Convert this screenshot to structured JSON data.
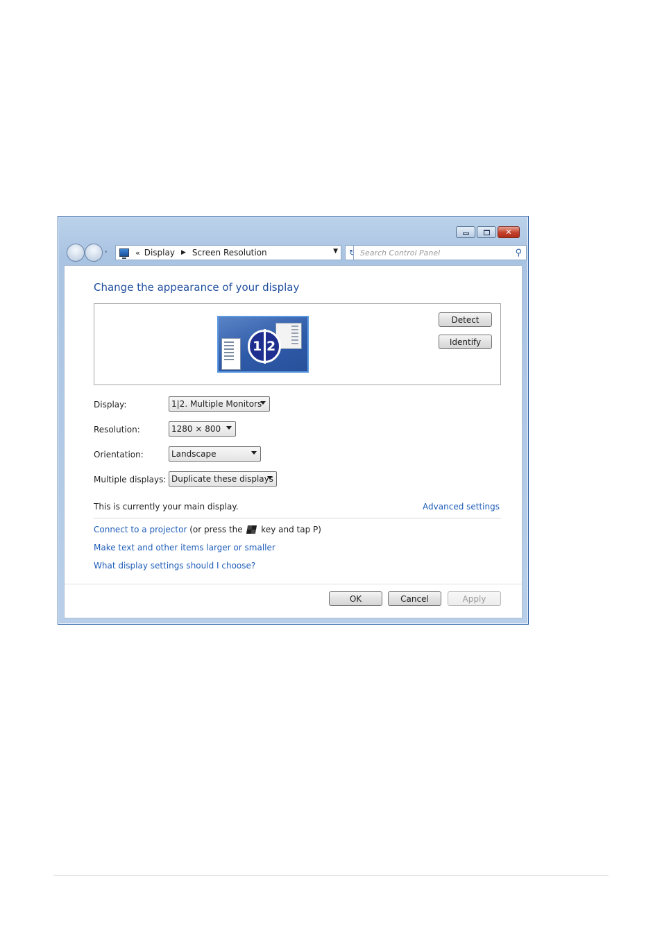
{
  "window": {
    "caption_buttons": {
      "minimize_icon": "minimize-icon",
      "maximize_icon": "maximize-icon",
      "close_icon": "close-icon",
      "close_glyph": "✕"
    },
    "nav": {
      "back_icon": "back-arrow-icon",
      "forward_icon": "forward-arrow-icon",
      "dropdown_glyph": "▾"
    },
    "address": {
      "chevron": "«",
      "breadcrumb": [
        "Display",
        "Screen Resolution"
      ],
      "separator": "▶",
      "dropdown_glyph": "▼"
    },
    "refresh_glyph": "↻",
    "search": {
      "placeholder": "Search Control Panel",
      "value": "",
      "icon_glyph": "⚲"
    }
  },
  "main": {
    "heading": "Change the appearance of your display",
    "preview": {
      "monitor_numbers": [
        "1",
        "2"
      ],
      "detect_label": "Detect",
      "identify_label": "Identify"
    },
    "settings": [
      {
        "label": "Display:",
        "value": "1|2. Multiple Monitors"
      },
      {
        "label": "Resolution:",
        "value": "1280 × 800"
      },
      {
        "label": "Orientation:",
        "value": "Landscape"
      },
      {
        "label": "Multiple displays:",
        "value": "Duplicate these displays"
      }
    ],
    "main_display_note": "This is currently your main display.",
    "advanced_link": "Advanced settings",
    "projector": {
      "link": "Connect to a projector",
      "text_before_key": " (or press the ",
      "text_after_key": " key and tap P)"
    },
    "links": [
      "Make text and other items larger or smaller",
      "What display settings should I choose?"
    ]
  },
  "footer": {
    "ok_label": "OK",
    "cancel_label": "Cancel",
    "apply_label": "Apply"
  },
  "colors": {
    "link": "#1e5db8",
    "heading": "#1f4e9e",
    "title_bar": "#a9c3e2",
    "close_button": "#c3402a"
  }
}
